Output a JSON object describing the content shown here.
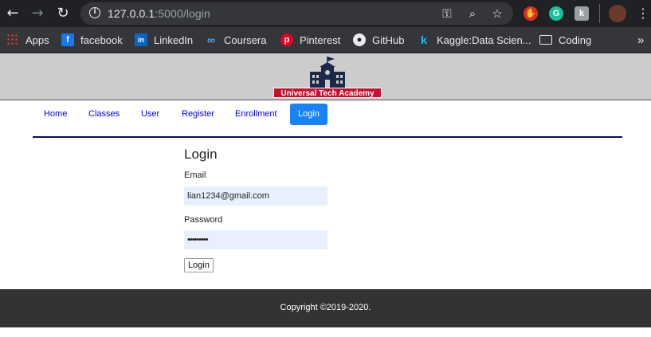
{
  "browser": {
    "url_host": "127.0.0.1",
    "url_path": ":5000/login",
    "bookmarks": [
      {
        "label": "Apps",
        "icon": "apps-grid-icon"
      },
      {
        "label": "facebook",
        "icon": "facebook-icon"
      },
      {
        "label": "LinkedIn",
        "icon": "linkedin-icon"
      },
      {
        "label": "Coursera",
        "icon": "coursera-icon"
      },
      {
        "label": "Pinterest",
        "icon": "pinterest-icon"
      },
      {
        "label": "GitHub",
        "icon": "github-icon"
      },
      {
        "label": "Kaggle:Data Scien...",
        "icon": "kaggle-icon"
      },
      {
        "label": "Coding",
        "icon": "folder-icon"
      }
    ],
    "overflow": "»"
  },
  "site": {
    "logo_text": "Universal Tech Academy",
    "colors": {
      "header_band": "#cccccc",
      "logo_red": "#c8102e",
      "nav_active": "#1a82f7",
      "rule": "#0b0b5e",
      "footer": "#333333"
    }
  },
  "nav": {
    "items": [
      {
        "label": "Home",
        "active": false
      },
      {
        "label": "Classes",
        "active": false
      },
      {
        "label": "User",
        "active": false
      },
      {
        "label": "Register",
        "active": false
      },
      {
        "label": "Enrollment",
        "active": false
      },
      {
        "label": "Login",
        "active": true
      }
    ]
  },
  "form": {
    "title": "Login",
    "email_label": "Email",
    "email_value": "lian1234@gmail.com",
    "password_label": "Password",
    "password_value": "•••••••••",
    "submit_label": "Login"
  },
  "footer": {
    "copyright": "Copyright ©2019-2020."
  }
}
